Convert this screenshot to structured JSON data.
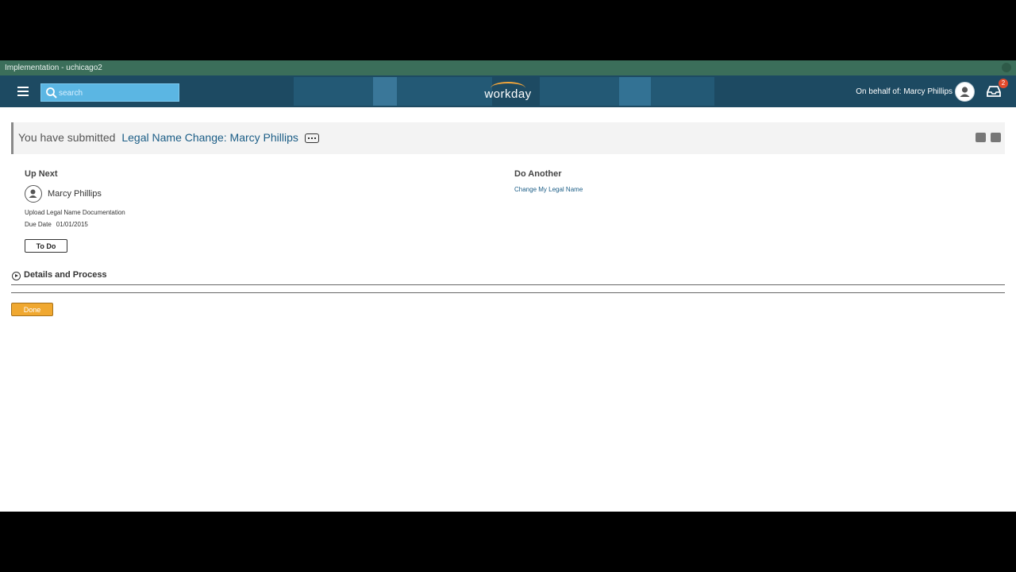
{
  "env": {
    "title": "Implementation - uchicago2"
  },
  "topbar": {
    "search_placeholder": "search",
    "logo_text": "workday",
    "on_behalf": "On behalf of: Marcy Phillips",
    "inbox_badge": "2"
  },
  "page": {
    "submitted_prefix": "You have submitted",
    "submitted_link": "Legal Name Change: Marcy Phillips"
  },
  "up_next": {
    "title": "Up Next",
    "person": "Marcy Phillips",
    "task": "Upload Legal Name Documentation",
    "due_label": "Due Date",
    "due_value": "01/01/2015",
    "todo_label": "To Do"
  },
  "do_another": {
    "title": "Do Another",
    "link": "Change My Legal Name"
  },
  "details": {
    "label": "Details and Process"
  },
  "done_label": "Done",
  "colors": {
    "brand_bar": "#1d4a62",
    "env_bar": "#3b6e5a",
    "link": "#1b5d86",
    "done": "#f0a830"
  }
}
